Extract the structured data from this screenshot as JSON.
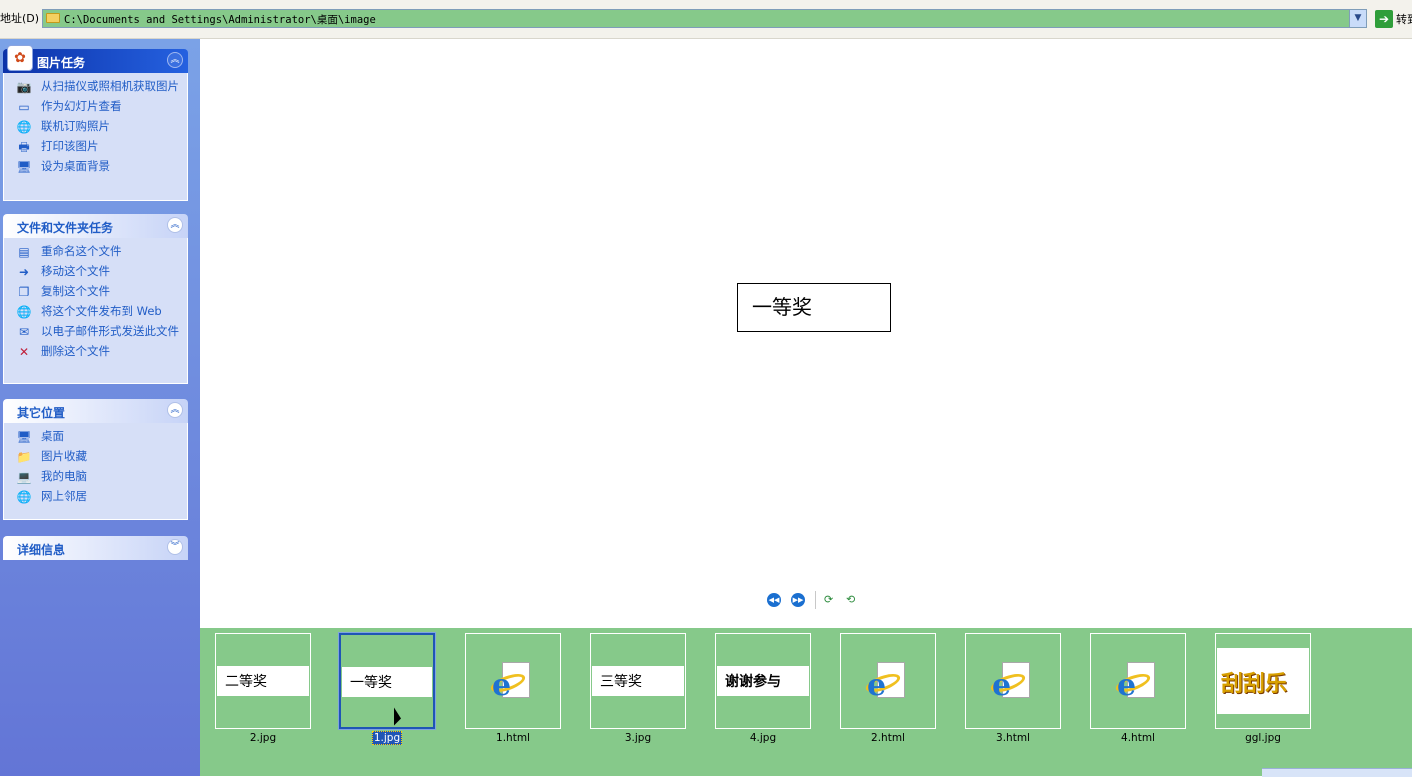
{
  "address_bar": {
    "label": "地址(D)",
    "path": "C:\\Documents and Settings\\Administrator\\桌面\\image",
    "dropdown_icon": "chevron-down-icon",
    "go_label": "转到"
  },
  "sidebar": {
    "picture_tasks": {
      "title": "图片任务",
      "items": [
        {
          "label": "从扫描仪或照相机获取图片",
          "icon": "camera-icon"
        },
        {
          "label": "作为幻灯片查看",
          "icon": "slideshow-icon"
        },
        {
          "label": "联机订购照片",
          "icon": "globe-icon"
        },
        {
          "label": "打印该图片",
          "icon": "printer-icon"
        },
        {
          "label": "设为桌面背景",
          "icon": "desktop-background-icon"
        }
      ]
    },
    "file_tasks": {
      "title": "文件和文件夹任务",
      "items": [
        {
          "label": "重命名这个文件",
          "icon": "rename-icon"
        },
        {
          "label": "移动这个文件",
          "icon": "move-icon"
        },
        {
          "label": "复制这个文件",
          "icon": "copy-icon"
        },
        {
          "label": "将这个文件发布到 Web",
          "icon": "web-publish-icon"
        },
        {
          "label": "以电子邮件形式发送此文件",
          "icon": "email-icon"
        },
        {
          "label": "删除这个文件",
          "icon": "delete-icon"
        }
      ]
    },
    "other_places": {
      "title": "其它位置",
      "items": [
        {
          "label": "桌面",
          "icon": "desktop-icon"
        },
        {
          "label": "图片收藏",
          "icon": "pictures-folder-icon"
        },
        {
          "label": "我的电脑",
          "icon": "my-computer-icon"
        },
        {
          "label": "网上邻居",
          "icon": "network-icon"
        }
      ]
    },
    "details": {
      "title": "详细信息"
    }
  },
  "preview": {
    "image_text": "一等奖"
  },
  "filmstrip": [
    {
      "label": "2.jpg",
      "kind": "text",
      "text": "二等奖"
    },
    {
      "label": "1.jpg",
      "kind": "text",
      "text": "一等奖",
      "selected": true
    },
    {
      "label": "1.html",
      "kind": "ie"
    },
    {
      "label": "3.jpg",
      "kind": "text",
      "text": "三等奖"
    },
    {
      "label": "4.jpg",
      "kind": "text",
      "text": "谢谢参与"
    },
    {
      "label": "2.html",
      "kind": "ie"
    },
    {
      "label": "3.html",
      "kind": "ie"
    },
    {
      "label": "4.html",
      "kind": "ie"
    },
    {
      "label": "ggl.jpg",
      "kind": "logo",
      "text": "刮刮乐"
    }
  ],
  "colors": {
    "address_field": "#86c98a",
    "filmstrip_bg": "#86c98a",
    "selection": "#1f55b5",
    "sidebar_link": "#215dc6"
  }
}
